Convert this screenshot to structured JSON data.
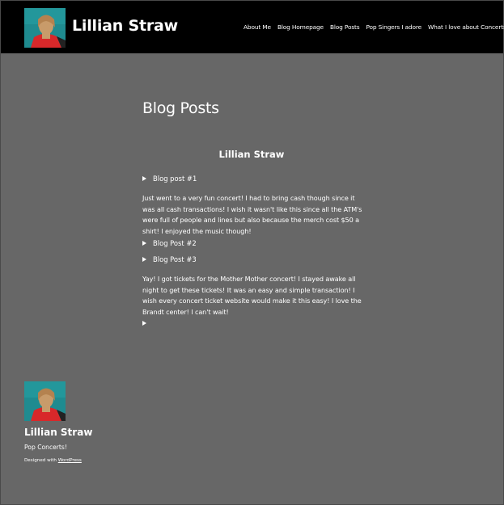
{
  "header": {
    "site_title": "Lillian Straw",
    "nav": [
      "About Me",
      "Blog Homepage",
      "Blog Posts",
      "Pop Singers I adore",
      "What I love about Concerts"
    ]
  },
  "main": {
    "page_heading": "Blog Posts",
    "author": "Lillian Straw",
    "post1_label": "Blog post #1",
    "paragraph1": "Just went to a very fun concert! I had to bring cash though since it was all cash transactions! I wish it wasn't like this since all the ATM's were full of people and lines but also because the merch cost $50 a shirt! I enjoyed the music though!",
    "post2_label": "Blog Post #2",
    "post3_label": "Blog Post #3",
    "paragraph2": "Yay! I got tickets for the Mother Mother concert! I stayed awake all night to get these tickets! It was an easy and simple transaction! I wish every concert ticket website would make it this easy! I love the Brandt center! I can't wait!"
  },
  "footer": {
    "site_title": "Lillian Straw",
    "tagline": "Pop Concerts!",
    "credit_prefix": "Designed with ",
    "credit_link": "WordPress"
  },
  "colors": {
    "page_bg": "#676767",
    "header_bg": "#000000",
    "text": "#ffffff"
  },
  "icons": {
    "logo": "portrait-avatar-icon",
    "disclosure": "triangle-right-icon"
  }
}
